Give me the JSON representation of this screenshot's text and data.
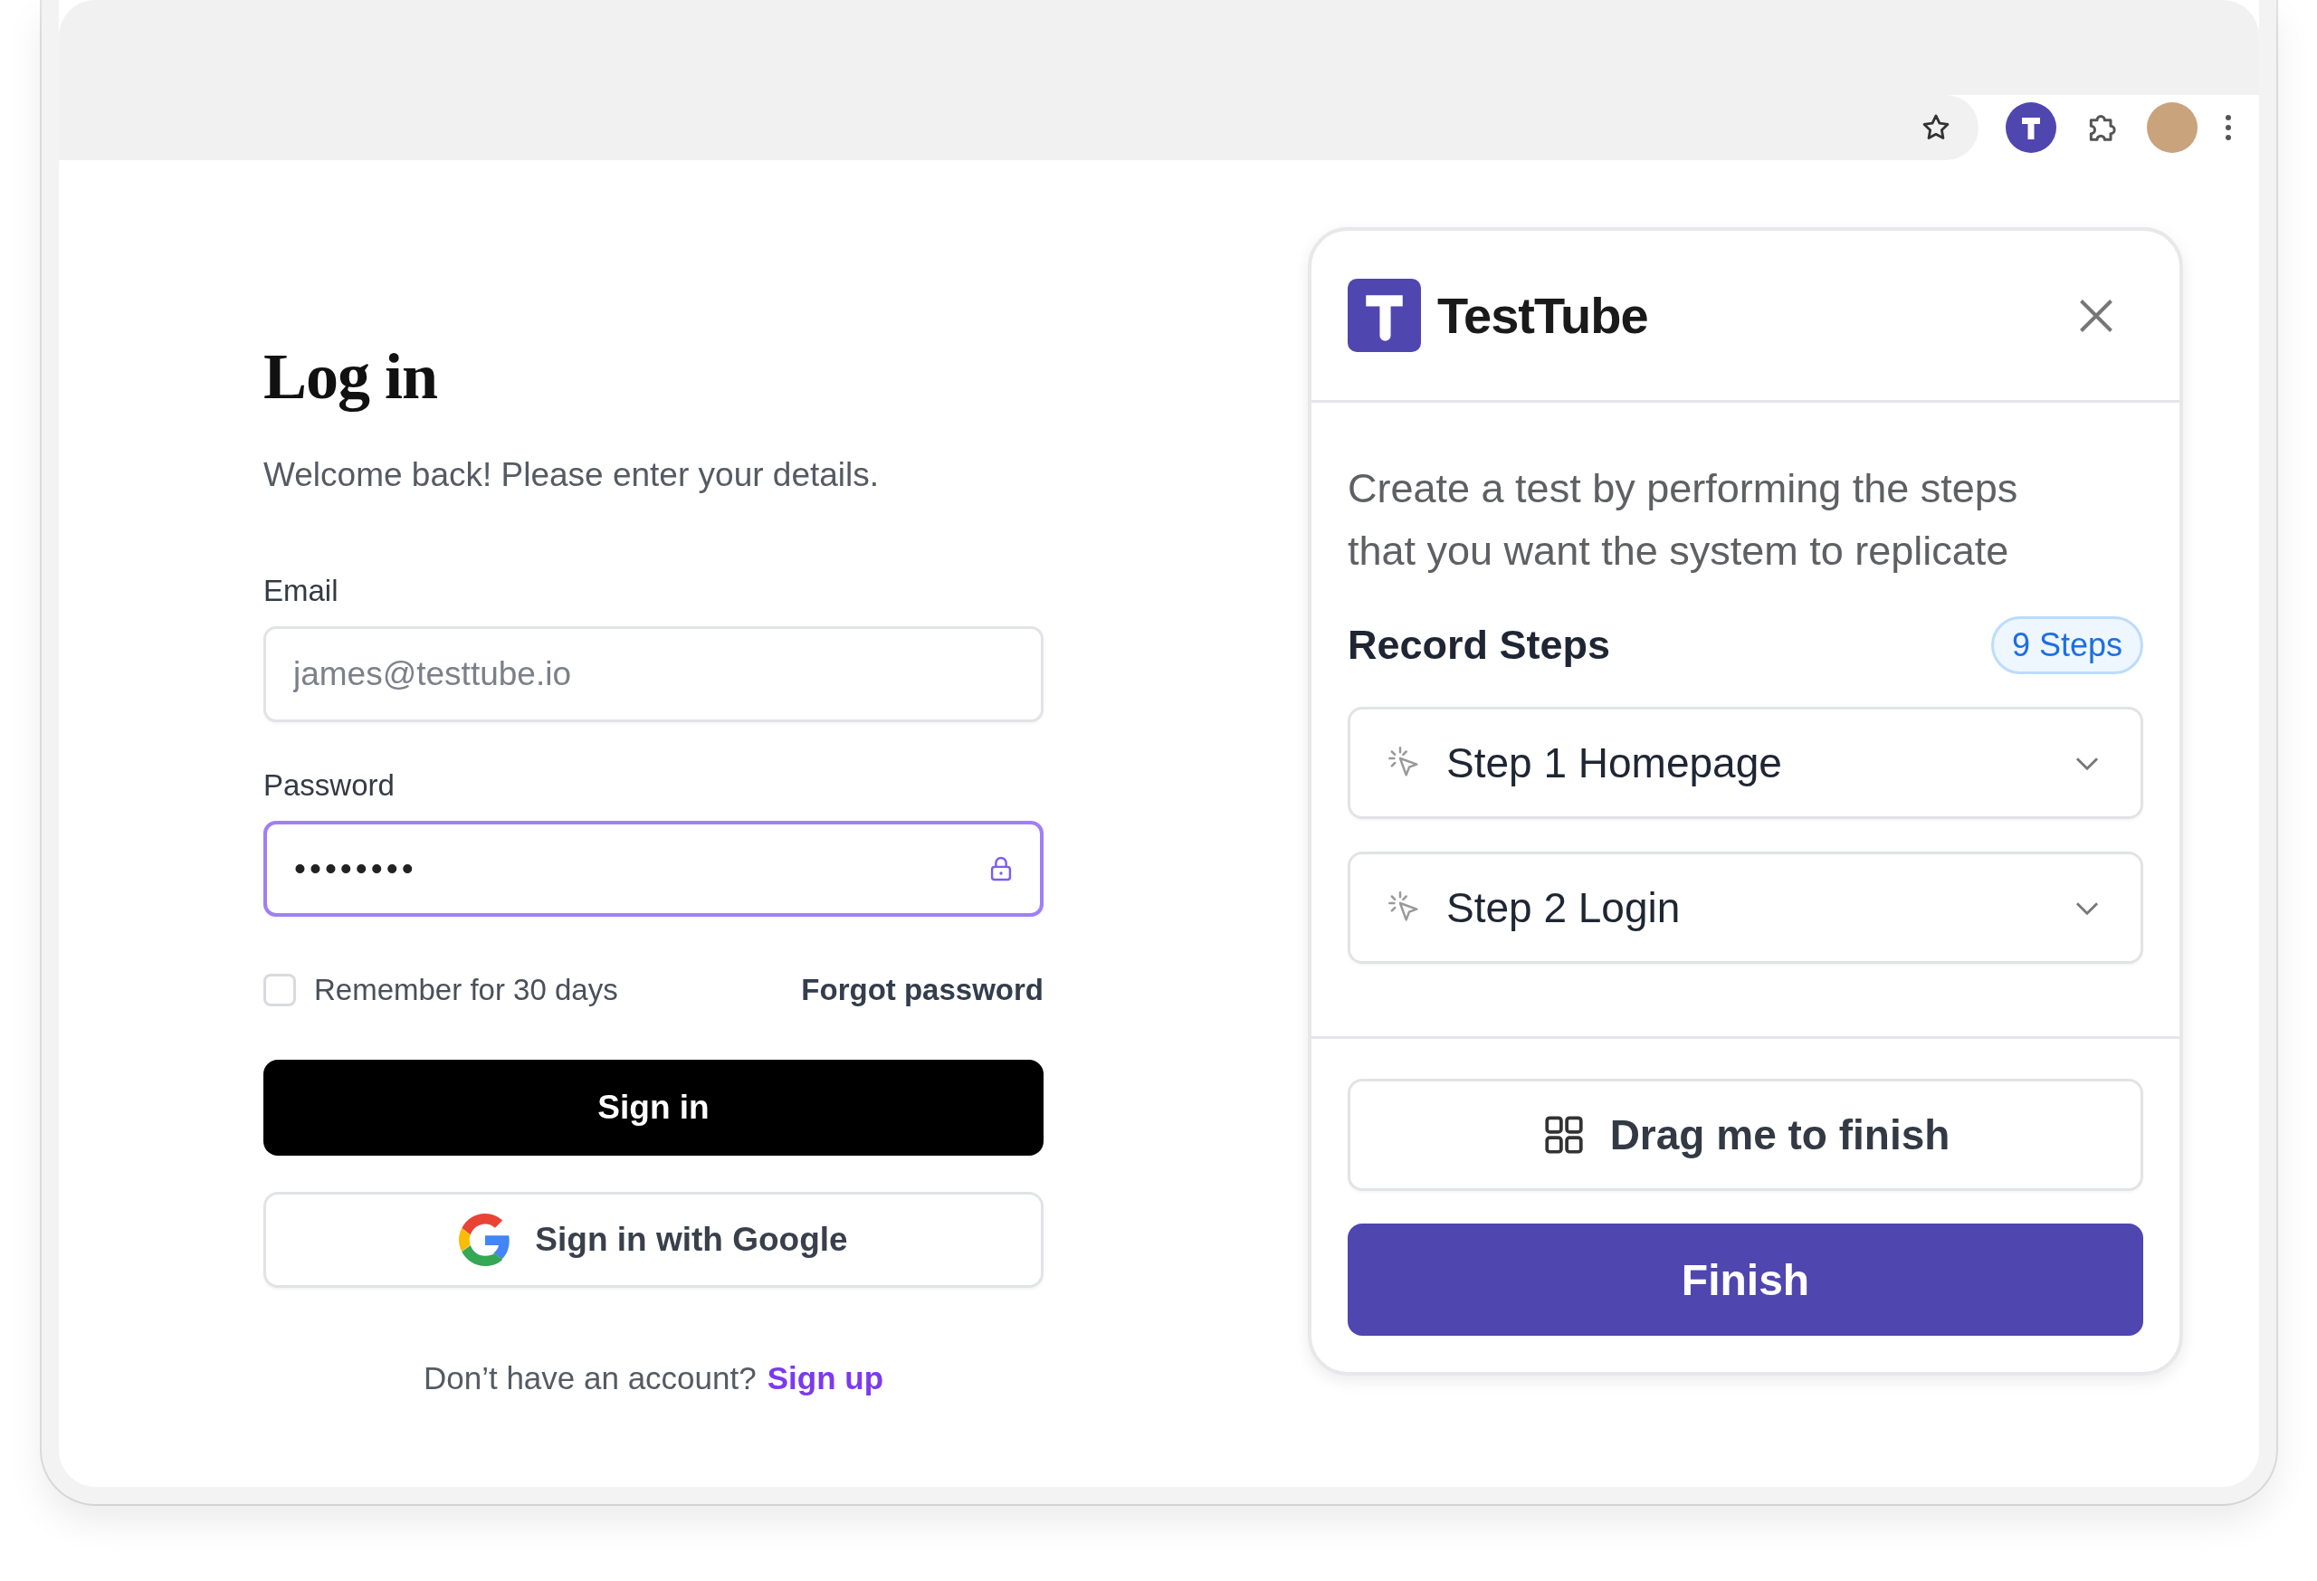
{
  "login": {
    "title": "Log in",
    "subtitle": "Welcome back! Please enter your details.",
    "fields": [
      {
        "kind": "email",
        "label": "Email",
        "placeholder": "james@testtube.io",
        "focused": false
      },
      {
        "kind": "password",
        "label": "Password",
        "value": "••••••••",
        "focused": true
      }
    ],
    "remember": {
      "label": "Remember for 30 days",
      "checked": false
    },
    "forgot_link": "Forgot password",
    "sign_in_button": "Sign in",
    "google_button": "Sign in with Google",
    "signup_prompt": {
      "text": "Don’t have an account?",
      "link": "Sign up"
    }
  },
  "panel": {
    "title": "TestTube",
    "description": "Create a test by performing the steps that you want the system to replicate",
    "section_title": "Record Steps",
    "badge": "9 Steps",
    "steps": [
      {
        "label": "Step 1 Homepage",
        "expanded": false
      },
      {
        "label": "Step 2 Login",
        "expanded": false
      }
    ],
    "drag_button": "Drag me to finish",
    "finish_button": "Finish"
  }
}
